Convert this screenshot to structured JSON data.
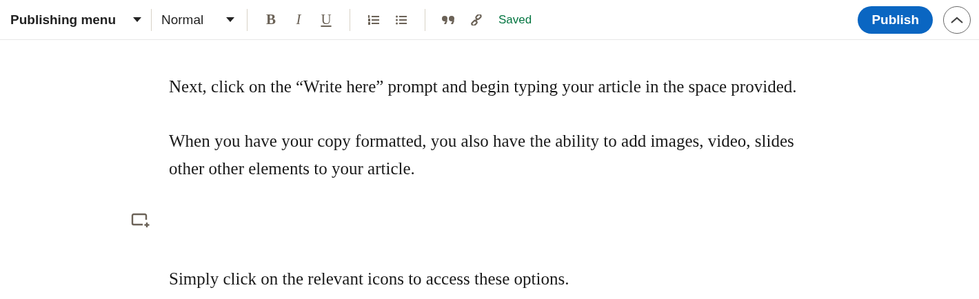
{
  "toolbar": {
    "menu": "Publishing menu",
    "style": "Normal",
    "formats": [
      {
        "kind": "bold",
        "label": "B"
      },
      {
        "kind": "italic",
        "label": "I"
      },
      {
        "kind": "underline",
        "label": "U"
      }
    ],
    "status": "Saved",
    "publish": "Publish"
  },
  "content": [
    {
      "kind": "paragraph",
      "text": "Next, click on the “Write here” prompt and begin typing your article in the space provided."
    },
    {
      "kind": "paragraph",
      "text": "When you have your copy formatted, you also have the ability to add images, video, slides other other elements to your article."
    },
    {
      "kind": "media"
    },
    {
      "kind": "paragraph",
      "text": "Simply click on the relevant icons to access these options."
    }
  ]
}
